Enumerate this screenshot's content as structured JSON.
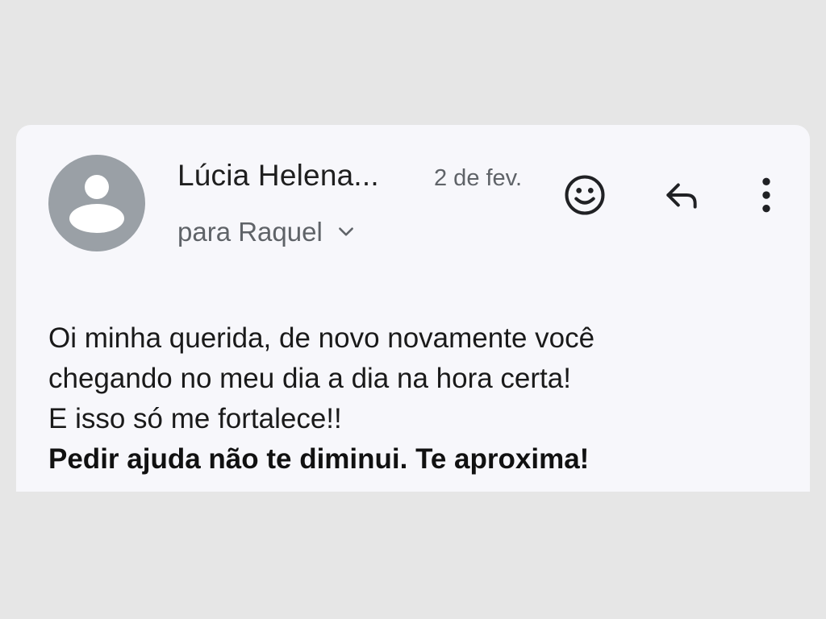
{
  "message": {
    "sender": "Lúcia Helena...",
    "date": "2 de fev.",
    "recipient": "para Raquel",
    "body_lines": [
      "Oi minha querida, de novo novamente você",
      "chegando no meu dia a dia na hora certa!",
      "E isso só me fortalece!!"
    ],
    "body_bold": "Pedir ajuda não te diminui. Te aproxima!"
  },
  "icons": {
    "avatar": "person-icon",
    "recipient_toggle": "chevron-down-icon",
    "emoji": "smiley-icon",
    "reply": "reply-icon",
    "more": "more-vert-icon"
  },
  "colors": {
    "card_background": "#f7f7fb",
    "page_background": "#e6e6e6",
    "avatar_background": "#9aa0a6"
  }
}
